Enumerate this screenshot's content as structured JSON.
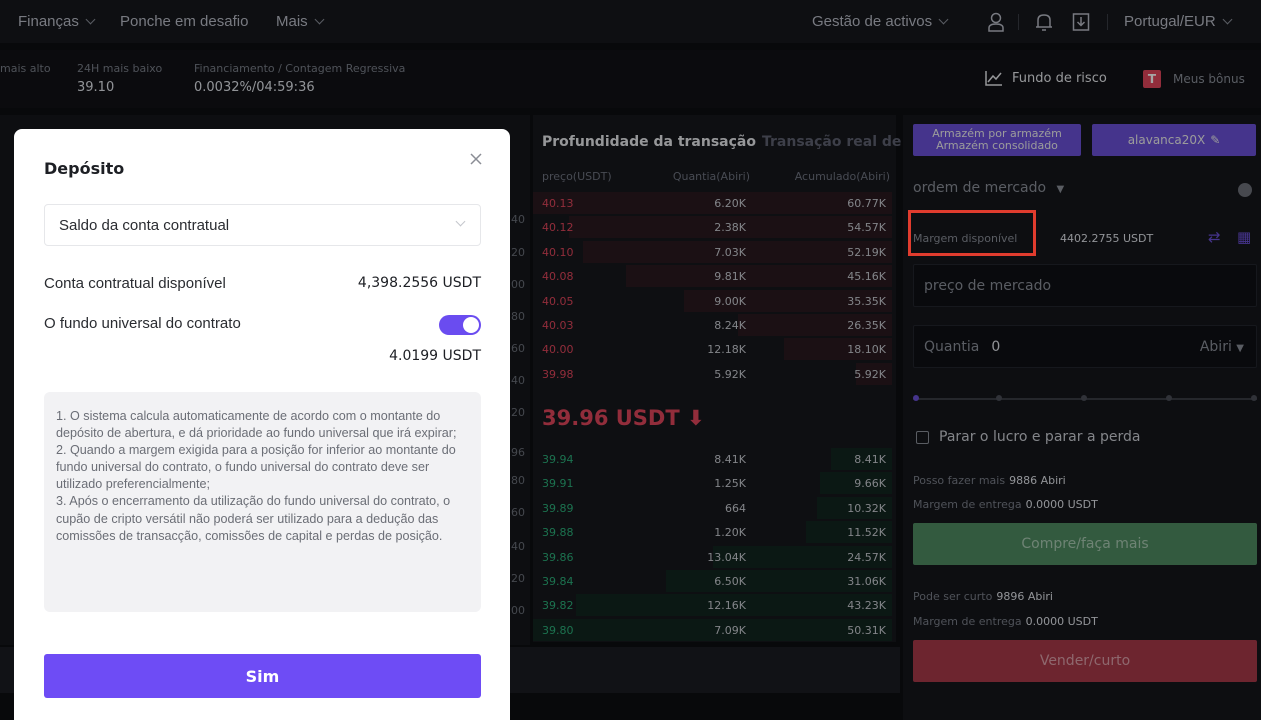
{
  "topnav": {
    "financas": "Finanças",
    "ponche": "Ponche em desafio",
    "mais": "Mais",
    "gestao": "Gestão de activos",
    "region": "Portugal/EUR"
  },
  "ticker": {
    "high_label": "mais alto",
    "low_label": "24H mais baixo",
    "low_value": "39.10",
    "funding_label": "Financiamento / Contagem Regressiva",
    "funding_value": "0.0032%/04:59:36",
    "risk_fund": "Fundo de risco",
    "bonus": "Meus bônus"
  },
  "chart_axis": [
    "40",
    "20",
    "00",
    "80",
    "60",
    "40",
    "20",
    "96",
    "80",
    "60",
    "40",
    "20",
    "00"
  ],
  "orderbook": {
    "tab_active": "Profundidade da transação",
    "tab_other": "Transação real de tempo",
    "col_price": "preço(USDT)",
    "col_qty": "Quantia(Abiri)",
    "col_cum": "Acumulado(Abiri)",
    "asks": [
      {
        "p": "40.13",
        "q": "6.20K",
        "c": "60.77K",
        "depth": 1.0
      },
      {
        "p": "40.12",
        "q": "2.38K",
        "c": "54.57K",
        "depth": 0.9
      },
      {
        "p": "40.10",
        "q": "7.03K",
        "c": "52.19K",
        "depth": 0.86
      },
      {
        "p": "40.08",
        "q": "9.81K",
        "c": "45.16K",
        "depth": 0.74
      },
      {
        "p": "40.05",
        "q": "9.00K",
        "c": "35.35K",
        "depth": 0.58
      },
      {
        "p": "40.03",
        "q": "8.24K",
        "c": "26.35K",
        "depth": 0.43
      },
      {
        "p": "40.00",
        "q": "12.18K",
        "c": "18.10K",
        "depth": 0.3
      },
      {
        "p": "39.98",
        "q": "5.92K",
        "c": "5.92K",
        "depth": 0.1
      }
    ],
    "mid_price": "39.96 USDT ⬇",
    "bids": [
      {
        "p": "39.94",
        "q": "8.41K",
        "c": "8.41K",
        "depth": 0.17
      },
      {
        "p": "39.91",
        "q": "1.25K",
        "c": "9.66K",
        "depth": 0.2
      },
      {
        "p": "39.89",
        "q": "664",
        "c": "10.32K",
        "depth": 0.21
      },
      {
        "p": "39.88",
        "q": "1.20K",
        "c": "11.52K",
        "depth": 0.24
      },
      {
        "p": "39.86",
        "q": "13.04K",
        "c": "24.57K",
        "depth": 0.5
      },
      {
        "p": "39.84",
        "q": "6.50K",
        "c": "31.06K",
        "depth": 0.63
      },
      {
        "p": "39.82",
        "q": "12.16K",
        "c": "43.23K",
        "depth": 0.88
      },
      {
        "p": "39.80",
        "q": "7.09K",
        "c": "50.31K",
        "depth": 1.0
      }
    ]
  },
  "trade": {
    "position_btn_line1": "Armazém por armazém",
    "position_btn_line2": "Armazém consolidado",
    "leverage_btn": "alavanca20X",
    "order_type": "ordem de mercado",
    "margin_label": "Margem disponível",
    "margin_value": "4402.2755 USDT",
    "price_field": "preço de mercado",
    "qty_label": "Quantia",
    "qty_value": "0",
    "qty_unit": "Abiri",
    "tpsl": "Parar o lucro e parar a perda",
    "can_long_label": "Posso fazer mais",
    "can_long_value": "9886 Abiri",
    "delivery_margin_label": "Margem de entrega",
    "delivery_margin_value": "0.0000 USDT",
    "buy_btn": "Compre/faça mais",
    "can_short_label": "Pode ser curto",
    "can_short_value": "9896 Abiri",
    "delivery_margin_label2": "Margem de entrega",
    "delivery_margin_value2": "0.0000 USDT",
    "sell_btn": "Vender/curto"
  },
  "modal": {
    "title": "Depósito",
    "select_value": "Saldo da conta contratual",
    "available_label": "Conta contratual disponível",
    "available_value": "4,398.2556 USDT",
    "universal_label": "O fundo universal do contrato",
    "universal_value": "4.0199 USDT",
    "notes": [
      "1. O sistema calcula automaticamente de acordo com o montante do depósito de abertura, e dá prioridade ao fundo universal que irá expirar;",
      "2. Quando a margem exigida para a posição for inferior ao montante do fundo universal do contrato, o fundo universal do contrato deve ser utilizado preferencialmente;",
      "3. Após o encerramento da utilização do fundo universal do contrato, o cupão de cripto versátil não poderá ser utilizado para a dedução das comissões de transacção, comissões de capital e perdas de posição."
    ],
    "confirm_btn": "Sim"
  },
  "colors": {
    "accent": "#6e4cf5",
    "ask": "#e0465b",
    "bid": "#2bb07a",
    "highlight_box": "#e03c2e"
  }
}
